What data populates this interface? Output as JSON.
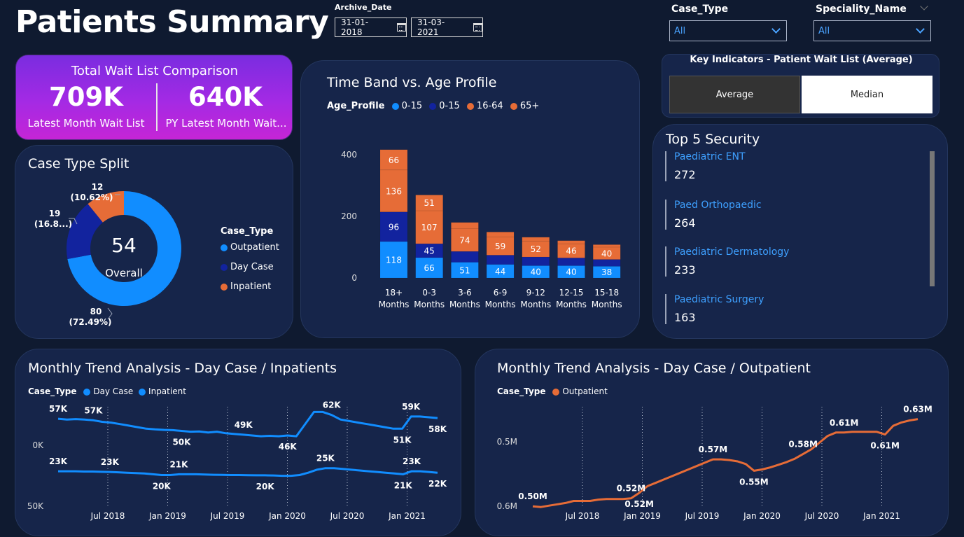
{
  "header": {
    "title": "Patients Summary"
  },
  "filters": {
    "archive_label": "Archive_Date",
    "start_date": "31-01-2018",
    "end_date": "31-03-2021",
    "case_type_label": "Case_Type",
    "case_type_value": "All",
    "speciality_label": "Speciality_Name",
    "speciality_value": "All"
  },
  "kpi": {
    "title": "Total Wait List Comparison",
    "latest_value": "709K",
    "latest_label": "Latest Month Wait List",
    "py_value": "640K",
    "py_label": "PY Latest Month Wait..."
  },
  "key_indicators": {
    "title": "Key Indicators - Patient Wait List (Average)",
    "average_label": "Average",
    "median_label": "Median",
    "selected": "Average"
  },
  "case_type_split": {
    "title": "Case Type Split",
    "center_value": "54",
    "center_label": "Overall",
    "legend_title": "Case_Type",
    "segments": [
      {
        "name": "Outpatient",
        "value": 80,
        "label_value": "80",
        "label_pct": "(72.49%)",
        "color": "#118dff"
      },
      {
        "name": "Day Case",
        "value": 19,
        "label_value": "19",
        "label_pct": "(16.8...)",
        "color": "#12239e"
      },
      {
        "name": "Inpatient",
        "value": 12,
        "label_value": "12",
        "label_pct": "(10.62%)",
        "color": "#e66c37"
      }
    ]
  },
  "time_band": {
    "title": "Time Band vs. Age Profile",
    "legend_title": "Age_Profile",
    "legend": [
      {
        "name": "0-15",
        "color": "#118dff"
      },
      {
        "name": "0-15",
        "color": "#12239e"
      },
      {
        "name": "16-64",
        "color": "#e66c37"
      },
      {
        "name": "65+",
        "color": "#e66c37"
      }
    ]
  },
  "top5": {
    "title": "Top 5 Security",
    "items": [
      {
        "name": "Paediatric ENT",
        "value": "272"
      },
      {
        "name": "Paed Orthopaedic",
        "value": "264"
      },
      {
        "name": "Paediatric Dermatology",
        "value": "233"
      },
      {
        "name": "Paediatric Surgery",
        "value": "163"
      }
    ]
  },
  "trend_inpatient": {
    "title": "Monthly Trend Analysis - Day Case / Inpatients",
    "legend_title": "Case_Type",
    "legend": [
      {
        "name": "Day Case",
        "color": "#118dff"
      },
      {
        "name": "Inpatient",
        "color": "#118dff"
      }
    ]
  },
  "trend_outpatient": {
    "title": "Monthly Trend Analysis - Day Case / Outpatient",
    "legend_title": "Case_Type",
    "legend": [
      {
        "name": "Outpatient",
        "color": "#e66c37"
      }
    ]
  },
  "chart_data": [
    {
      "type": "pie",
      "categories": [
        "Outpatient",
        "Day Case",
        "Inpatient"
      ],
      "values": [
        80,
        19,
        12
      ],
      "title": "Case Type Split"
    },
    {
      "type": "bar",
      "title": "Time Band vs. Age Profile",
      "categories": [
        "18+ Months",
        "0-3 Months",
        "3-6 Months",
        "6-9 Months",
        "9-12 Months",
        "12-15 Months",
        "15-18 Months"
      ],
      "ylim": [
        0,
        420
      ],
      "yticks": [
        0,
        200,
        400
      ],
      "series": [
        {
          "name": "0-15",
          "color": "#118dff",
          "values": [
            118,
            66,
            51,
            44,
            40,
            40,
            38
          ],
          "labels": [
            "118",
            "66",
            "51",
            "44",
            "40",
            "40",
            "38"
          ]
        },
        {
          "name": "0-15",
          "color": "#12239e",
          "values": [
            96,
            45,
            35,
            30,
            28,
            25,
            22
          ],
          "labels": [
            "96",
            "45",
            "",
            "",
            "",
            "",
            ""
          ]
        },
        {
          "name": "16-64",
          "color": "#e66c37",
          "values": [
            136,
            107,
            74,
            59,
            52,
            46,
            40
          ],
          "labels": [
            "136",
            "107",
            "74",
            "59",
            "52",
            "46",
            "40"
          ]
        },
        {
          "name": "65+",
          "color": "#e66c37",
          "values": [
            66,
            51,
            20,
            16,
            12,
            10,
            8
          ],
          "labels": [
            "66",
            "51",
            "",
            "",
            "",
            "",
            ""
          ]
        }
      ]
    },
    {
      "type": "line",
      "title": "Monthly Trend Analysis - Day Case / Inpatients",
      "x_ticks": [
        "Jul 2018",
        "Jan 2019",
        "Jul 2019",
        "Jan 2020",
        "Jul 2020",
        "Jan 2021"
      ],
      "y_ticks": [
        "0K",
        "50K"
      ],
      "ylim": [
        0,
        70
      ],
      "series": [
        {
          "name": "Day Case",
          "color": "#118dff",
          "values": [
            57.5,
            57,
            57.3,
            57,
            56.5,
            55.5,
            55,
            54,
            53,
            52,
            51,
            50.5,
            50.2,
            50,
            49.5,
            49,
            49.2,
            48.5,
            49,
            48,
            47.5,
            47,
            46.5,
            46,
            46.3,
            46,
            46.5,
            46,
            54,
            62,
            62,
            60,
            57,
            56,
            55,
            54,
            53,
            52,
            51,
            51,
            59,
            59,
            58.5,
            58
          ],
          "labels": [
            {
              "index": 0,
              "text": "57K",
              "pos": "above"
            },
            {
              "index": 4,
              "text": "57K",
              "pos": "above"
            },
            {
              "index": 14,
              "text": "50K",
              "pos": "below"
            },
            {
              "index": 21,
              "text": "49K",
              "pos": "above"
            },
            {
              "index": 26,
              "text": "46K",
              "pos": "below"
            },
            {
              "index": 31,
              "text": "62K",
              "pos": "above"
            },
            {
              "index": 39,
              "text": "51K",
              "pos": "below"
            },
            {
              "index": 40,
              "text": "59K",
              "pos": "above"
            },
            {
              "index": 43,
              "text": "58K",
              "pos": "below"
            }
          ]
        },
        {
          "name": "Inpatient",
          "color": "#118dff",
          "values": [
            23,
            23,
            23,
            22.8,
            22.8,
            22.6,
            22.5,
            22.3,
            22,
            21.8,
            21.5,
            21,
            20.5,
            20.5,
            21,
            21,
            21,
            20.8,
            20.7,
            20.6,
            20.5,
            20.5,
            20.4,
            20.3,
            20.3,
            20.2,
            20,
            20,
            20.5,
            22,
            24,
            25,
            25,
            24.5,
            24,
            23.5,
            23,
            22.5,
            22,
            21.5,
            21,
            23,
            23,
            22.5,
            22
          ],
          "labels": [
            {
              "index": 0,
              "text": "23K",
              "pos": "above"
            },
            {
              "index": 6,
              "text": "23K",
              "pos": "above"
            },
            {
              "index": 12,
              "text": "20K",
              "pos": "below"
            },
            {
              "index": 14,
              "text": "21K",
              "pos": "above"
            },
            {
              "index": 24,
              "text": "20K",
              "pos": "below"
            },
            {
              "index": 31,
              "text": "25K",
              "pos": "above"
            },
            {
              "index": 40,
              "text": "21K",
              "pos": "below"
            },
            {
              "index": 41,
              "text": "23K",
              "pos": "above"
            },
            {
              "index": 44,
              "text": "22K",
              "pos": "below"
            }
          ]
        }
      ]
    },
    {
      "type": "line",
      "title": "Monthly Trend Analysis - Day Case / Outpatient",
      "x_ticks": [
        "Jul 2018",
        "Jan 2019",
        "Jul 2019",
        "Jan 2020",
        "Jul 2020",
        "Jan 2021"
      ],
      "y_ticks": [
        "0.5M",
        "0.6M"
      ],
      "ylim": [
        0.495,
        0.64
      ],
      "series": [
        {
          "name": "Outpatient",
          "color": "#e66c37",
          "values": [
            0.5,
            0.499,
            0.501,
            0.503,
            0.505,
            0.508,
            0.508,
            0.508,
            0.51,
            0.511,
            0.511,
            0.511,
            0.512,
            0.52,
            0.53,
            0.535,
            0.54,
            0.545,
            0.55,
            0.555,
            0.56,
            0.565,
            0.57,
            0.57,
            0.569,
            0.567,
            0.563,
            0.553,
            0.555,
            0.558,
            0.562,
            0.566,
            0.571,
            0.578,
            0.585,
            0.595,
            0.605,
            0.61,
            0.61,
            0.611,
            0.611,
            0.611,
            0.611,
            0.607,
            0.62,
            0.625,
            0.628,
            0.63
          ],
          "labels": [
            {
              "index": 0,
              "text": "0.50M",
              "pos": "above"
            },
            {
              "index": 12,
              "text": "0.52M",
              "pos": "above"
            },
            {
              "index": 13,
              "text": "0.52M",
              "pos": "below"
            },
            {
              "index": 22,
              "text": "0.57M",
              "pos": "above"
            },
            {
              "index": 27,
              "text": "0.55M",
              "pos": "below"
            },
            {
              "index": 33,
              "text": "0.58M",
              "pos": "above"
            },
            {
              "index": 38,
              "text": "0.61M",
              "pos": "above"
            },
            {
              "index": 43,
              "text": "0.61M",
              "pos": "below"
            },
            {
              "index": 47,
              "text": "0.63M",
              "pos": "above"
            }
          ]
        }
      ]
    }
  ]
}
